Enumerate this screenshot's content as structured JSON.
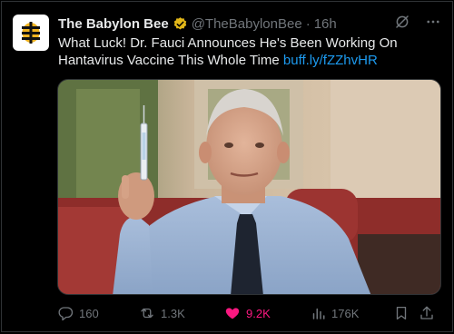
{
  "tweet": {
    "author_name": "The Babylon Bee",
    "handle": "@TheBabylonBee",
    "separator": "·",
    "time": "16h",
    "text": "What Luck! Dr. Fauci Announces He's Been Working On Hantavirus Vaccine This Whole Time",
    "link": "buff.ly/fZZhvHR"
  },
  "actions": {
    "replies": "160",
    "reposts": "1.3K",
    "likes": "9.2K",
    "views": "176K"
  },
  "icons": {
    "verified": "verified-badge-icon",
    "grok": "grok-icon",
    "more": "more-icon",
    "reply": "reply-icon",
    "repost": "repost-icon",
    "like": "heart-icon",
    "views": "views-icon",
    "bookmark": "bookmark-icon",
    "share": "share-icon"
  },
  "colors": {
    "background": "#000000",
    "text": "#e7e9ea",
    "muted": "#71767b",
    "link": "#1d9bf0",
    "like": "#f91880",
    "verified": "#e2b719"
  }
}
